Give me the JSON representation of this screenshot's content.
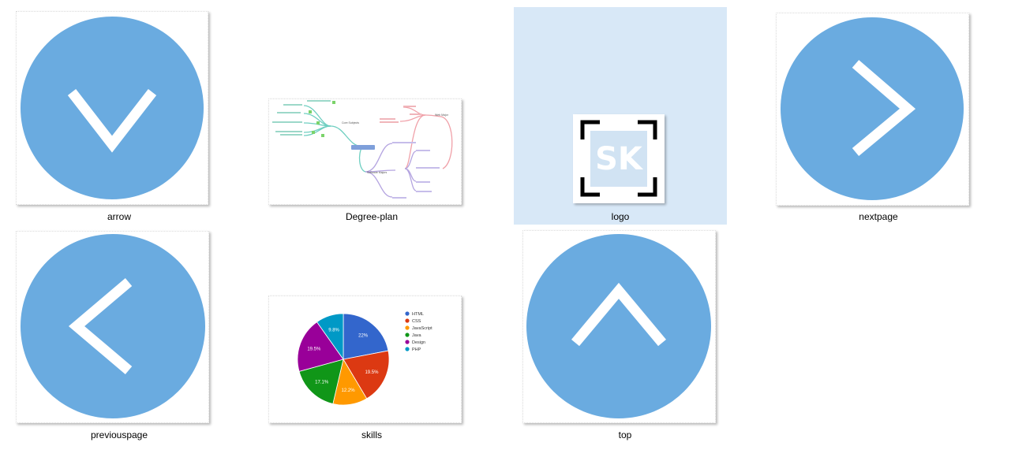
{
  "folder": {
    "files": [
      {
        "name": "arrow"
      },
      {
        "name": "Degree-plan"
      },
      {
        "name": "logo"
      },
      {
        "name": "nextpage"
      },
      {
        "name": "previouspage"
      },
      {
        "name": "skills"
      },
      {
        "name": "top"
      }
    ]
  },
  "colors": {
    "circle_blue": "#6aabe0",
    "selection": "#d8e8f7"
  },
  "icons": {
    "arrow": "chevron-down-icon",
    "nextpage": "chevron-right-icon",
    "previouspage": "chevron-left-icon",
    "top": "chevron-up-icon"
  },
  "logo": {
    "text": "SK"
  },
  "skills_chart": {
    "chart_data": {
      "type": "pie",
      "categories": [
        "HTML",
        "CSS",
        "JavaScript",
        "Java",
        "Design",
        "PHP"
      ],
      "values": [
        22,
        19.5,
        12.2,
        17.1,
        19.5,
        9.8
      ],
      "labels": [
        "22%",
        "19.5%",
        "12.2%",
        "17.1%",
        "19.5%",
        "9.8%"
      ],
      "colors": [
        "#3366cc",
        "#dc3912",
        "#ff9900",
        "#109618",
        "#990099",
        "#0099c6"
      ],
      "legend": "right"
    }
  }
}
